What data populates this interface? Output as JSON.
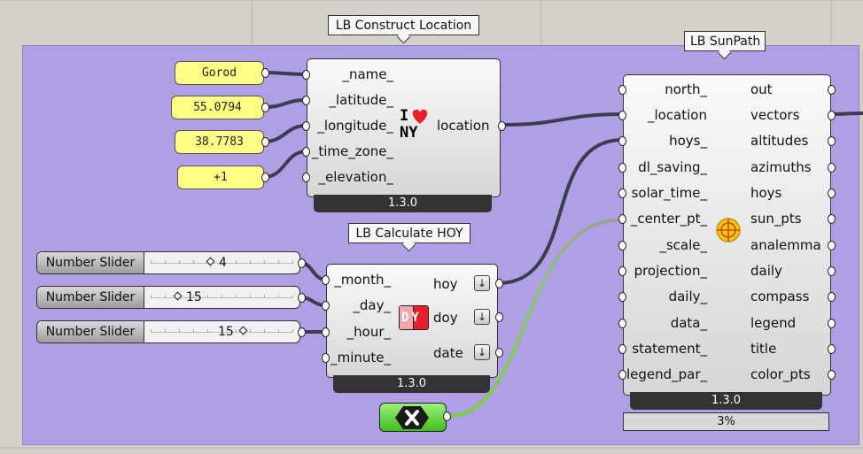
{
  "construct_location": {
    "title": "LB Construct Location",
    "inputs": [
      "_name_",
      "_latitude_",
      "_longitude_",
      "_time_zone_",
      "_elevation_"
    ],
    "output": "location",
    "icon_text": "I",
    "icon_text_bottom": "NY",
    "version": "1.3.0"
  },
  "panels": [
    "Gorod",
    "55.0794",
    "38.7783",
    "+1"
  ],
  "calculate_hoy": {
    "title": "LB Calculate HOY",
    "inputs": [
      "_month_",
      "_day_",
      "_hour_",
      "_minute_"
    ],
    "outputs": [
      "hoy",
      "doy",
      "date"
    ],
    "icon_text": "DY",
    "version": "1.3.0"
  },
  "sliders": [
    {
      "name": "Number Slider",
      "value": "4",
      "fraction": 0.45
    },
    {
      "name": "Number Slider",
      "value": "15",
      "fraction": 0.22
    },
    {
      "name": "Number Slider",
      "value": "15",
      "fraction": 0.68
    }
  ],
  "sunpath": {
    "title": "LB SunPath",
    "inputs": [
      "north_",
      "_location",
      "hoys_",
      "dl_saving_",
      "solar_time_",
      "_center_pt_",
      "_scale_",
      "projection_",
      "daily_",
      "data_",
      "statement_",
      "legend_par_"
    ],
    "outputs": [
      "out",
      "vectors",
      "altitudes",
      "azimuths",
      "hoys",
      "sun_pts",
      "analemma",
      "daily",
      "compass",
      "legend",
      "title",
      "color_pts"
    ],
    "version": "1.3.0",
    "progress": "3%"
  },
  "colors": {
    "group": "#b19fe6",
    "panel": "#fefe84",
    "toggle": "#5fd73a",
    "wire": "#3d3d52",
    "wire_green": "#78d23c"
  },
  "icons": {
    "location_icon": "i-love-ny-icon",
    "hoy_icon": "dy-calendar-icon",
    "sunpath_icon": "sun-target-icon",
    "toggle_icon": "x-hexagon-icon",
    "arrow": "↓"
  }
}
